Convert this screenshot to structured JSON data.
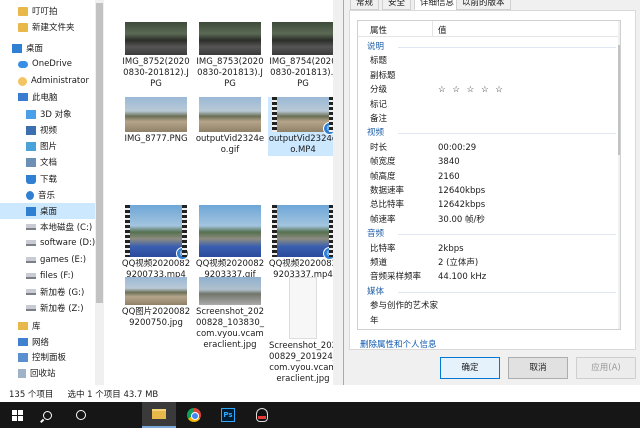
{
  "explorer": {
    "nav": [
      {
        "label": "叮叮拍",
        "icon": "folder-icon",
        "indent": 1
      },
      {
        "label": "新建文件夹",
        "icon": "folder-icon",
        "indent": 1
      },
      {
        "label": "桌面",
        "icon": "desktop-icon",
        "indent": 0
      },
      {
        "label": "OneDrive",
        "icon": "cloud-icon",
        "indent": 1
      },
      {
        "label": "Administrator",
        "icon": "user-icon",
        "indent": 1
      },
      {
        "label": "此电脑",
        "icon": "computer-icon",
        "indent": 1
      },
      {
        "label": "3D 对象",
        "icon": "cube-icon",
        "indent": 2
      },
      {
        "label": "视频",
        "icon": "video-icon",
        "indent": 2
      },
      {
        "label": "图片",
        "icon": "picture-icon",
        "indent": 2
      },
      {
        "label": "文档",
        "icon": "document-icon",
        "indent": 2
      },
      {
        "label": "下载",
        "icon": "download-icon",
        "indent": 2
      },
      {
        "label": "音乐",
        "icon": "music-icon",
        "indent": 2
      },
      {
        "label": "桌面",
        "icon": "desktop-icon",
        "indent": 2,
        "selected": true
      },
      {
        "label": "本地磁盘 (C:)",
        "icon": "drive-icon",
        "indent": 2
      },
      {
        "label": "software (D:)",
        "icon": "drive-icon",
        "indent": 2
      },
      {
        "label": "games (E:)",
        "icon": "drive-icon",
        "indent": 2
      },
      {
        "label": "files (F:)",
        "icon": "drive-icon",
        "indent": 2
      },
      {
        "label": "新加卷 (G:)",
        "icon": "drive-icon",
        "indent": 2
      },
      {
        "label": "新加卷 (Z:)",
        "icon": "drive-icon",
        "indent": 2
      },
      {
        "label": "库",
        "icon": "library-icon",
        "indent": 1
      },
      {
        "label": "网络",
        "icon": "network-icon",
        "indent": 1
      },
      {
        "label": "控制面板",
        "icon": "control-panel-icon",
        "indent": 1
      },
      {
        "label": "回收站",
        "icon": "recycle-bin-icon",
        "indent": 1
      }
    ],
    "files": [
      {
        "name": "IMG_8752(20200830-201812).JPG",
        "thumb": "dark",
        "video": false
      },
      {
        "name": "IMG_8753(20200830-201813).JPG",
        "thumb": "dark",
        "video": false
      },
      {
        "name": "IMG_8754(20200830-201813).JPG",
        "thumb": "dark",
        "video": false
      },
      {
        "name": "IMG_8777.PNG",
        "thumb": "road",
        "video": false
      },
      {
        "name": "outputVid2324eo.gif",
        "thumb": "road",
        "video": false
      },
      {
        "name": "outputVid2324eo.MP4",
        "thumb": "road",
        "video": true,
        "selected": true
      },
      {
        "name": "QQ视频20200829200733.mp4",
        "thumb": "blue",
        "video": true
      },
      {
        "name": "QQ视频20200829203337.gif",
        "thumb": "blue",
        "video": false
      },
      {
        "name": "QQ视频20200829203337.mp4",
        "thumb": "blue",
        "video": true
      },
      {
        "name": "QQ图片20200829200750.jpg",
        "thumb": "road",
        "video": false
      },
      {
        "name": "Screenshot_20200828_103830_com.vyou.vcameraclient.jpg",
        "thumb": "screen",
        "video": false
      },
      {
        "name": "Screenshot_20200829_201924_com.vyou.vcameraclient.jpg",
        "thumb": "phone",
        "video": false
      }
    ],
    "status": {
      "count": "135 个项目",
      "selection": "选中 1 个项目  43.7 MB"
    }
  },
  "dialog": {
    "tabs": [
      {
        "label": "常规",
        "active": false
      },
      {
        "label": "安全",
        "active": false
      },
      {
        "label": "详细信息",
        "active": true
      },
      {
        "label": "以前的版本",
        "active": false
      }
    ],
    "header": {
      "property": "属性",
      "value": "值"
    },
    "rows": [
      {
        "type": "section",
        "key": "说明",
        "value": ""
      },
      {
        "type": "row",
        "key": "标题",
        "value": ""
      },
      {
        "type": "row",
        "key": "副标题",
        "value": ""
      },
      {
        "type": "row",
        "key": "分级",
        "value": "☆ ☆ ☆ ☆ ☆",
        "stars": true
      },
      {
        "type": "row",
        "key": "标记",
        "value": ""
      },
      {
        "type": "row",
        "key": "备注",
        "value": ""
      },
      {
        "type": "section",
        "key": "视频",
        "value": ""
      },
      {
        "type": "row",
        "key": "时长",
        "value": "00:00:29"
      },
      {
        "type": "row",
        "key": "帧宽度",
        "value": "3840"
      },
      {
        "type": "row",
        "key": "帧高度",
        "value": "2160"
      },
      {
        "type": "row",
        "key": "数据速率",
        "value": "12640kbps"
      },
      {
        "type": "row",
        "key": "总比特率",
        "value": "12642kbps"
      },
      {
        "type": "row",
        "key": "帧速率",
        "value": "30.00 帧/秒"
      },
      {
        "type": "section",
        "key": "音频",
        "value": ""
      },
      {
        "type": "row",
        "key": "比特率",
        "value": "2kbps"
      },
      {
        "type": "row",
        "key": "频道",
        "value": "2 (立体声)"
      },
      {
        "type": "row",
        "key": "音频采样频率",
        "value": "44.100 kHz"
      },
      {
        "type": "section",
        "key": "媒体",
        "value": ""
      },
      {
        "type": "row",
        "key": "参与创作的艺术家",
        "value": ""
      },
      {
        "type": "row",
        "key": "年",
        "value": ""
      }
    ],
    "remove_link": "删除属性和个人信息",
    "buttons": {
      "ok": "确定",
      "cancel": "取消",
      "apply": "应用(A)"
    }
  },
  "taskbar": {
    "items": [
      {
        "name": "start-button",
        "icon": "windows-icon"
      },
      {
        "name": "search-button",
        "icon": "search-icon"
      },
      {
        "name": "task-view-button",
        "icon": "cortana-icon"
      },
      {
        "name": "file-explorer-button",
        "icon": "folder-icon",
        "active": true
      },
      {
        "name": "chrome-button",
        "icon": "chrome-icon"
      },
      {
        "name": "photoshop-button",
        "icon": "photoshop-icon",
        "glyph": "Ps"
      },
      {
        "name": "qq-button",
        "icon": "qq-icon"
      }
    ]
  }
}
